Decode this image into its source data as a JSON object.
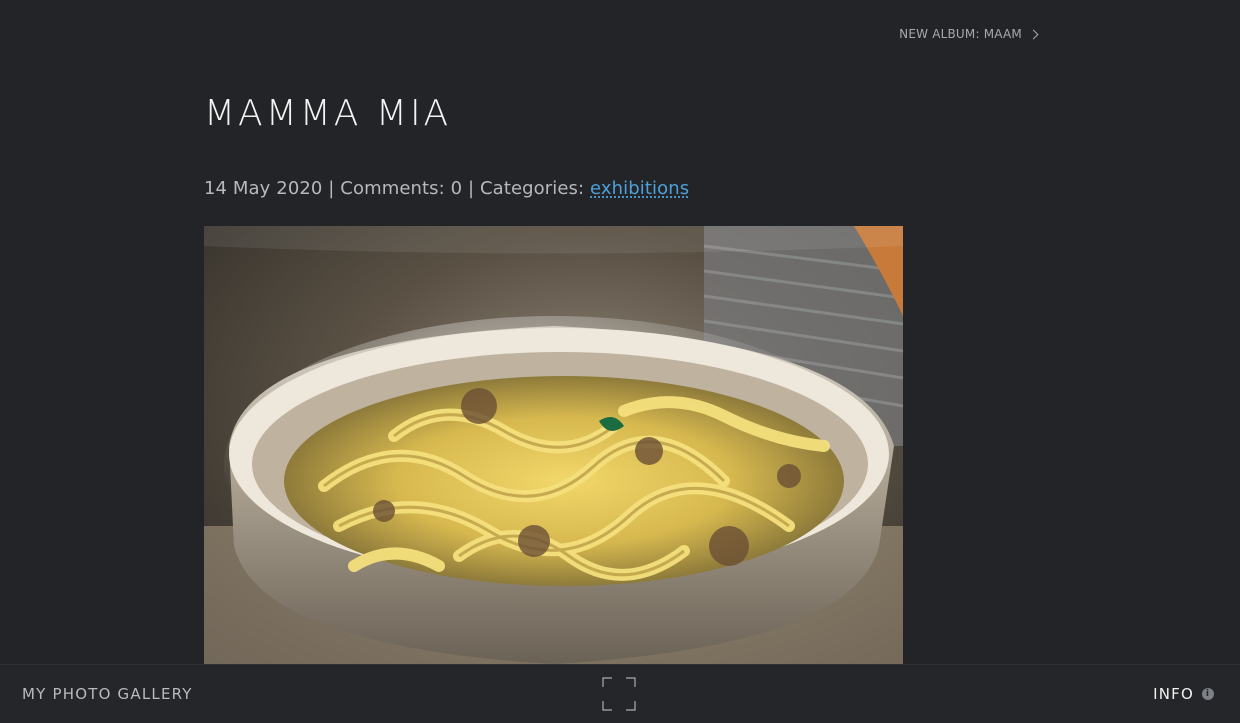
{
  "top_nav": {
    "next_album_label": "NEW ALBUM: MAAM",
    "next_icon": "chevron-right-icon"
  },
  "post": {
    "title": "MAMMA MIA",
    "date": "14 May 2020",
    "separator_1": " | ",
    "comments_label": "Comments: 0",
    "separator_2": " | ",
    "categories_label": "Categories: ",
    "category_link": "exhibitions"
  },
  "photo": {
    "subject": "pasta-dish-image"
  },
  "footer": {
    "site_title": "MY PHOTO GALLERY",
    "fullscreen_icon": "fullscreen-icon",
    "info_label": "INFO",
    "info_icon": "info-icon"
  },
  "colors": {
    "background": "#232428",
    "link": "#4ea0d8",
    "title": "#f3f3f3",
    "muted": "#b6b8bd"
  }
}
